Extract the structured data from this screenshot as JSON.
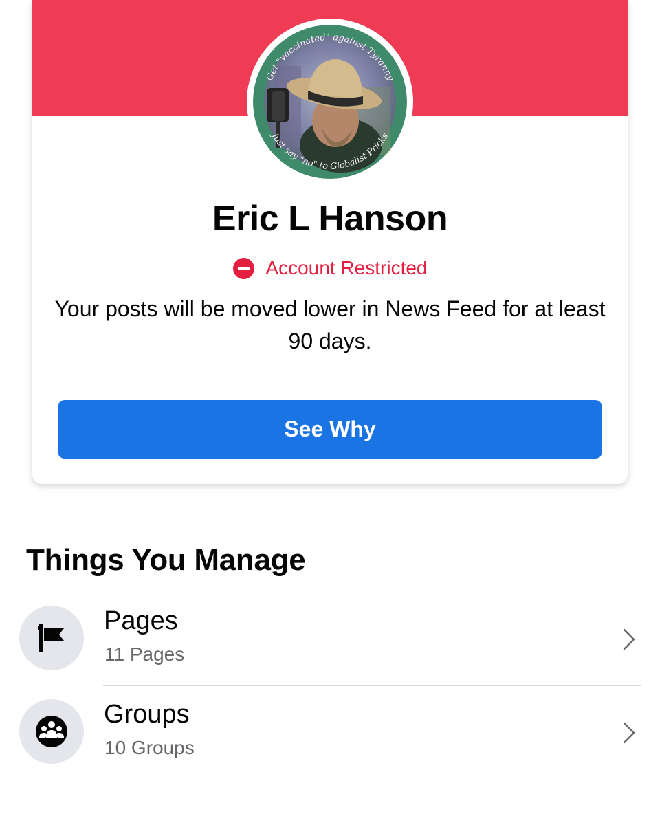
{
  "colors": {
    "cover": "#f03b55",
    "accent_blue": "#1b74e4",
    "restricted_red": "#e41e3f",
    "secondary_text": "#65676b"
  },
  "profile": {
    "name": "Eric L Hanson",
    "avatar": {
      "ring_text_top": "Get \"vaccinated\" against Tyranny",
      "ring_text_bottom": "Just say \"no\" to Globalist Pricks"
    },
    "status": {
      "icon": "restricted-icon",
      "label": "Account Restricted"
    },
    "message": "Your posts will be moved lower in News Feed for at least 90 days.",
    "cta_label": "See Why"
  },
  "manage": {
    "title": "Things You Manage",
    "items": [
      {
        "icon": "flag-icon",
        "title": "Pages",
        "subtitle": "11 Pages"
      },
      {
        "icon": "groups-icon",
        "title": "Groups",
        "subtitle": "10 Groups"
      }
    ]
  }
}
